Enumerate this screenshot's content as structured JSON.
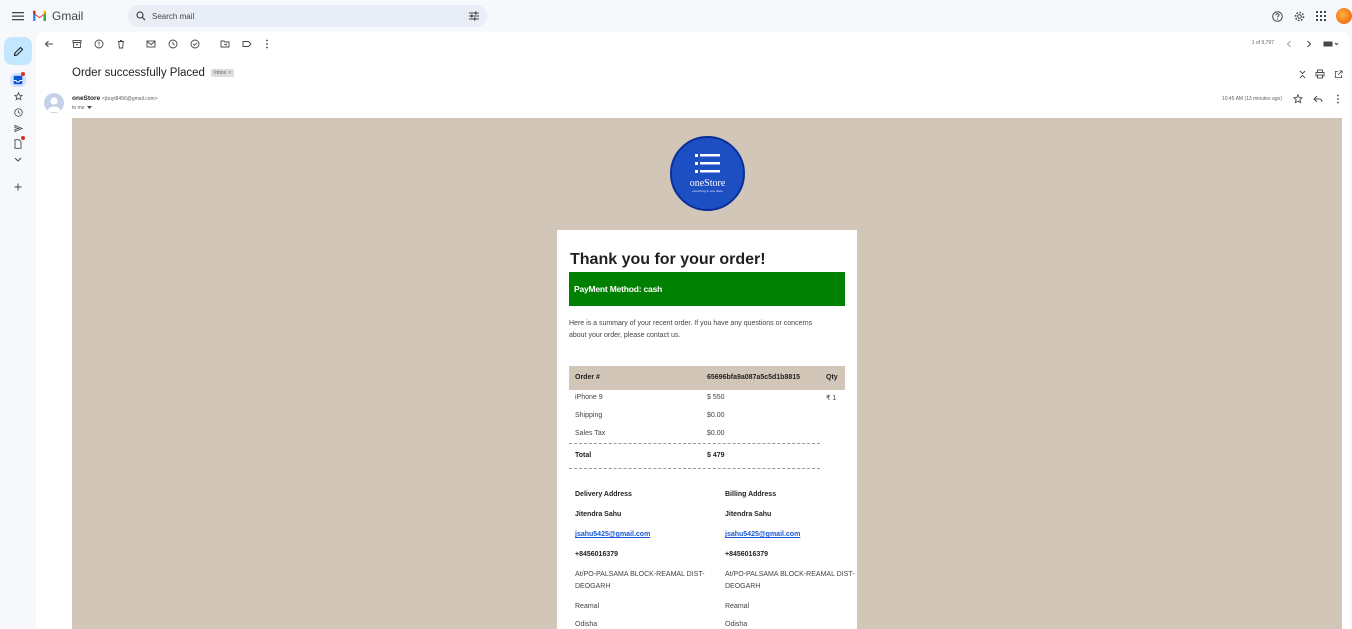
{
  "app": {
    "name": "Gmail",
    "search_placeholder": "Search mail"
  },
  "toolbar": {
    "pager": "1 of 9,797"
  },
  "message": {
    "subject": "Order successfully Placed",
    "label_chip": "Inbox",
    "label_chip_remove": "×",
    "sender_name": "oneStore",
    "sender_email": "<jbuyt8456@gmail.com>",
    "to": "to me",
    "time": "10:45 AM (13 minutes ago)"
  },
  "email": {
    "store_name": "oneStore",
    "store_tagline": "everything in one place",
    "heading": "Thank you for your order!",
    "payment_method": "PayMent Method: cash",
    "summary": "Here is a summary of your recent order. If you have any questions or concerns about your order, please contact us.",
    "order_header": {
      "label": "Order #",
      "order_id": "65696bfa9a087a5c5d1b8815",
      "qty": "Qty"
    },
    "items": [
      {
        "name": "iPhone 9",
        "price": "$ 550",
        "qty": "₹ 1"
      },
      {
        "name": "Shipping",
        "price": "$0.00",
        "qty": ""
      },
      {
        "name": "Sales Tax",
        "price": "$0.00",
        "qty": ""
      }
    ],
    "total": {
      "label": "Total",
      "value": "$ 479"
    },
    "delivery": {
      "title": "Delivery Address",
      "name": "Jitendra Sahu",
      "email": "jsahu5425@gmail.com",
      "phone": "+8456016379",
      "line1": "At/PO-PALSAMA BLOCK-REAMAL DIST-DEOGARH",
      "city": "Reamal",
      "state": "Odisha"
    },
    "billing": {
      "title": "Billing Address",
      "name": "Jitendra Sahu",
      "email": "jsahu5425@gmail.com",
      "phone": "+8456016379",
      "line1": "At/PO-PALSAMA BLOCK-REAMAL DIST-DEOGARH",
      "city": "Reamal",
      "state": "Odisha"
    }
  },
  "colors": {
    "compose_bg": "#c2e7ff",
    "email_bg": "#d2c6b9",
    "payment_green": "#008000",
    "logo_blue": "#1d4fc2"
  }
}
